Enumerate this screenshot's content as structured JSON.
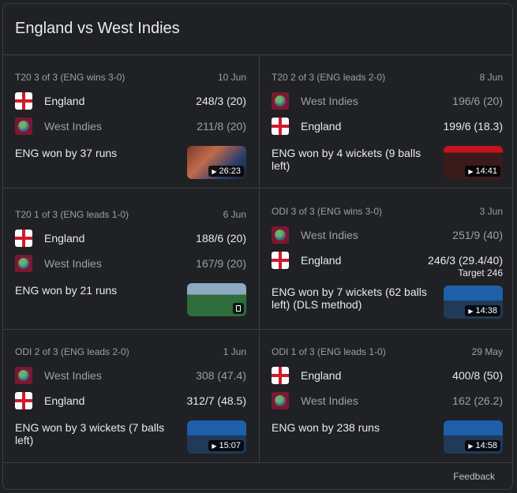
{
  "title": "England vs West Indies",
  "matches": [
    {
      "series": "T20 3 of 3 (ENG wins 3-0)",
      "date": "10 Jun",
      "teams": [
        {
          "name": "England",
          "flag": "england-flag",
          "score": "248/3 (20)",
          "winner": true
        },
        {
          "name": "West Indies",
          "flag": "west-indies-flag",
          "score": "211/8 (20)",
          "winner": false
        }
      ],
      "result": "ENG won by 37 runs",
      "target": "",
      "video_duration": "26:23"
    },
    {
      "series": "T20 2 of 3 (ENG leads 2-0)",
      "date": "8 Jun",
      "teams": [
        {
          "name": "West Indies",
          "flag": "west-indies-flag",
          "score": "196/6 (20)",
          "winner": false
        },
        {
          "name": "England",
          "flag": "england-flag",
          "score": "199/6 (18.3)",
          "winner": true
        }
      ],
      "result": "ENG won by 4 wickets (9 balls left)",
      "target": "",
      "video_duration": "14:41"
    },
    {
      "series": "T20 1 of 3 (ENG leads 1-0)",
      "date": "6 Jun",
      "teams": [
        {
          "name": "England",
          "flag": "england-flag",
          "score": "188/6 (20)",
          "winner": true
        },
        {
          "name": "West Indies",
          "flag": "west-indies-flag",
          "score": "167/9 (20)",
          "winner": false
        }
      ],
      "result": "ENG won by 21 runs",
      "target": "",
      "video_duration": ""
    },
    {
      "series": "ODI 3 of 3 (ENG wins 3-0)",
      "date": "3 Jun",
      "teams": [
        {
          "name": "West Indies",
          "flag": "west-indies-flag",
          "score": "251/9 (40)",
          "winner": false
        },
        {
          "name": "England",
          "flag": "england-flag",
          "score": "246/3 (29.4/40)",
          "winner": true
        }
      ],
      "result": "ENG won by 7 wickets (62 balls left) (DLS method)",
      "target": "Target 246",
      "video_duration": "14:38"
    },
    {
      "series": "ODI 2 of 3 (ENG leads 2-0)",
      "date": "1 Jun",
      "teams": [
        {
          "name": "West Indies",
          "flag": "west-indies-flag",
          "score": "308 (47.4)",
          "winner": false
        },
        {
          "name": "England",
          "flag": "england-flag",
          "score": "312/7 (48.5)",
          "winner": true
        }
      ],
      "result": "ENG won by 3 wickets (7 balls left)",
      "target": "",
      "video_duration": "15:07"
    },
    {
      "series": "ODI 1 of 3 (ENG leads 1-0)",
      "date": "29 May",
      "teams": [
        {
          "name": "England",
          "flag": "england-flag",
          "score": "400/8 (50)",
          "winner": true
        },
        {
          "name": "West Indies",
          "flag": "west-indies-flag",
          "score": "162 (26.2)",
          "winner": false
        }
      ],
      "result": "ENG won by 238 runs",
      "target": "",
      "video_duration": "14:58"
    }
  ],
  "feedback_label": "Feedback"
}
